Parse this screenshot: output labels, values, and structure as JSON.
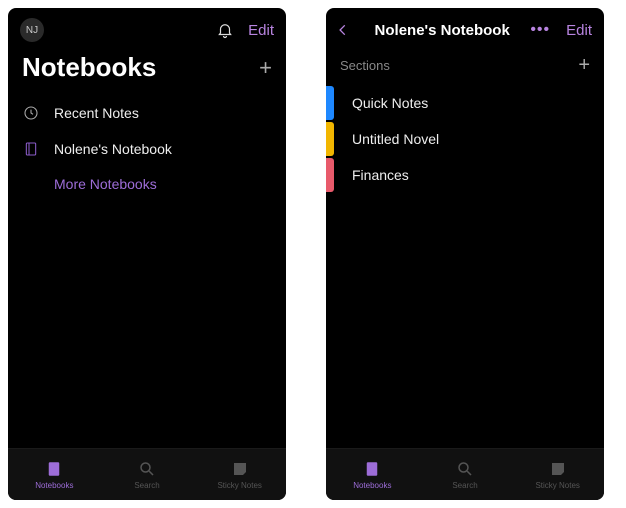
{
  "left": {
    "avatar": "NJ",
    "edit": "Edit",
    "title": "Notebooks",
    "rows": {
      "recent": "Recent Notes",
      "notebook": "Nolene's Notebook",
      "more": "More Notebooks"
    },
    "tabs": {
      "notebooks": "Notebooks",
      "search": "Search",
      "sticky": "Sticky Notes"
    }
  },
  "right": {
    "title": "Nolene's Notebook",
    "edit": "Edit",
    "sectionsLabel": "Sections",
    "sections": [
      {
        "name": "Quick Notes",
        "color": "#1e88ff"
      },
      {
        "name": "Untitled Novel",
        "color": "#f2b600"
      },
      {
        "name": "Finances",
        "color": "#e85a6b"
      }
    ],
    "tabs": {
      "notebooks": "Notebooks",
      "search": "Search",
      "sticky": "Sticky Notes"
    }
  }
}
